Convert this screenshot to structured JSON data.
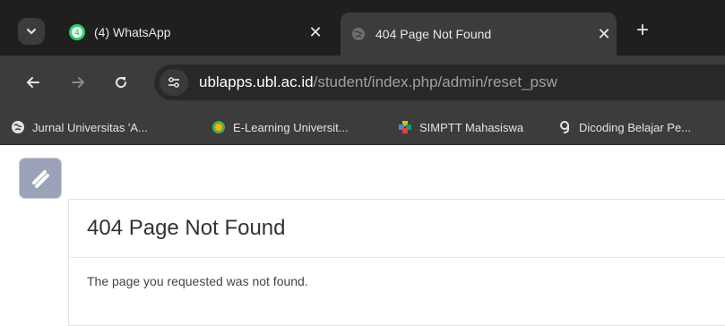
{
  "browser": {
    "tabs": [
      {
        "title": "(4) WhatsApp",
        "favicon": "whatsapp-icon",
        "badge": "4",
        "active": false
      },
      {
        "title": "404 Page Not Found",
        "favicon": "globe-icon",
        "active": true
      }
    ],
    "address": {
      "host": "ublapps.ubl.ac.id",
      "path": "/student/index.php/admin/reset_psw"
    },
    "bookmarks": [
      {
        "label": "Jurnal Universitas 'A...",
        "icon": "globe-icon"
      },
      {
        "label": "E-Learning Universit...",
        "icon": "elearning-icon"
      },
      {
        "label": "SIMPTT Mahasiswa",
        "icon": "simptt-icon"
      },
      {
        "label": "Dicoding Belajar Pe...",
        "icon": "dicoding-icon"
      }
    ]
  },
  "page": {
    "heading": "404 Page Not Found",
    "message": "The page you requested was not found."
  },
  "colors": {
    "tabstrip": "#1f1f1f",
    "toolbar": "#3c3c3c",
    "whatsapp": "#25d366",
    "accent_text": "#333333"
  }
}
